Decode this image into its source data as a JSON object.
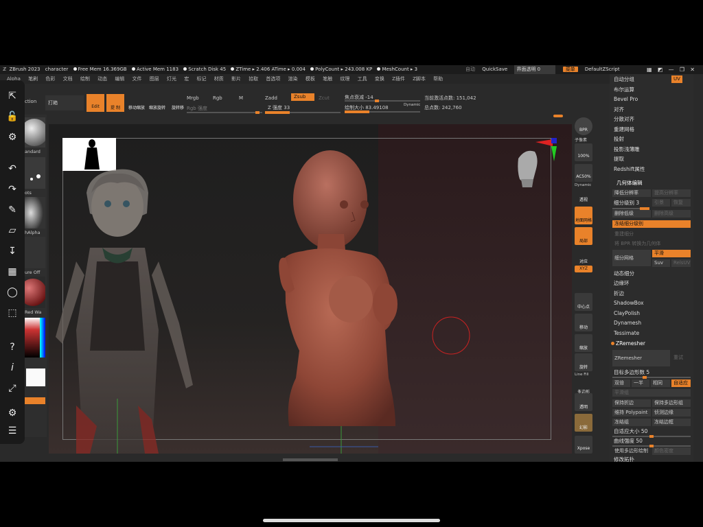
{
  "titlebar": {
    "app": "ZBrush 2023",
    "doc": "character",
    "free_mem": "Free Mem 16.369GB",
    "active_mem": "Active Mem 1183",
    "scratch": "Scratch Disk 45",
    "ztime": "ZTime ▸ 2.406 ATime ▸ 0.004",
    "polycount": "PolyCount ▸ 243.008 KP",
    "meshcount": "MeshCount ▸ 3",
    "auto": "自动",
    "quicksave": "QuickSave",
    "transparency": "界面透明 0",
    "menu_btn": "菜单",
    "script": "DefaultZScript"
  },
  "menubar": [
    "Alpha",
    "笔刷",
    "色彩",
    "文档",
    "绘制",
    "动态",
    "编辑",
    "文件",
    "图层",
    "灯光",
    "宏",
    "标记",
    "材质",
    "影片",
    "拾取",
    "首选项",
    "渲染",
    "模板",
    "笔触",
    "纹理",
    "工具",
    "变换",
    "Z插件",
    "Z脚本",
    "帮助"
  ],
  "shelf": {
    "section": "ction",
    "stroke_label": "打箱",
    "edit": "Edit",
    "move": "提 制",
    "btn1": "移动缩放",
    "btn2": "缩放旋转",
    "btn3": "旋转移",
    "mrgb": "Mrgb",
    "rgb": "Rgb",
    "m": "M",
    "rgb_intensity": "Rgb 强度",
    "zadd": "Zadd",
    "zsub": "Zsub",
    "zcut": "Zcut",
    "z_intensity": "Z 强度 33",
    "focal_shift": "焦点衰减 -14",
    "draw_size": "绘制大小 83.49108",
    "dynamic": "Dynamic",
    "active_points": "当前激活点数: 151,042",
    "total_points": "总点数: 242,760"
  },
  "leftpanel": {
    "brush": "andard",
    "dots": "ots",
    "alpha": "hAlpha",
    "texture": "ure Off",
    "material": "Red Wa"
  },
  "leftbar_icons": [
    "arrow-icon",
    "lock-icon",
    "gear-icon",
    "undo-icon",
    "redo-icon",
    "brush-icon",
    "eraser-icon",
    "pen-icon",
    "grid-icon",
    "lasso-icon",
    "select-icon",
    "help-icon",
    "info-icon",
    "expand-icon",
    "settings-icon",
    "menu-icon"
  ],
  "dock": {
    "bpr": "BPR",
    "subpixel": "子像素",
    "zoom100": "100%",
    "zoom50": "AC50%",
    "dynamic": "Dynamic",
    "persp": "透视",
    "floor": "地面网格",
    "local": "局部",
    "frame": "对应",
    "xyz": "XYZ",
    "center": "中心点",
    "move": "移动",
    "scale": "缩放",
    "rotate": "旋转",
    "linefill": "Line Fill",
    "polyf": "多边形",
    "transp": "透明",
    "ghost": "幻影",
    "xpose": "Xpose"
  },
  "rpanel": {
    "top_items": [
      "自动分组",
      "布尔运算",
      "Bevel Pro",
      "对齐",
      "分散对齐",
      "重建网格",
      "投射",
      "投影浅薄雕",
      "提取",
      "Redshift属性"
    ],
    "uv_btn": "UV",
    "section_geo": "几何体编辑",
    "lower_sub": "降低分辨率",
    "higher_sub": "提高分辨率",
    "sdiv": "细分级别 3",
    "cage": "引景",
    "restore": "恢复",
    "del_lower": "删除低级",
    "del_higher": "删除高级",
    "freeze": "冻结细分级别",
    "reconstruct": "重建细分",
    "bpr_conv": "将 BPR 转换为几何体",
    "divide": "细分网格",
    "smooth": "平滑",
    "suv": "Suv",
    "relsuv": "RelsUV",
    "dynsub": "动态细分",
    "edgeloop": "边缘环",
    "crease": "折边",
    "shadowbox": "ShadowBox",
    "claypolish": "ClayPolish",
    "dynamesh": "Dynamesh",
    "tessimate": "Tessimate",
    "zremesher_head": "ZRemesher",
    "zremesher_btn": "ZRemesher",
    "legacy": "重试",
    "target_poly": "目标多边形数 5",
    "half": "双倍",
    "one": "一半",
    "same": "相同",
    "adaptive": "自适应",
    "smooth_group": "平滑组",
    "keep_crease": "保持折边",
    "keep_groups": "保持多边形组",
    "keep_polypaint": "维持 Polypaint",
    "detect_edges": "侦测边缘",
    "freeze_groups": "冻结组",
    "freeze_border": "冻结边框",
    "adapt_size": "自适应大小 50",
    "curve_strength": "曲线强度 50",
    "use_polypaint": "使用多边形绘制",
    "color_density": "颜色密度",
    "modify_topo": "修改拓扑"
  }
}
